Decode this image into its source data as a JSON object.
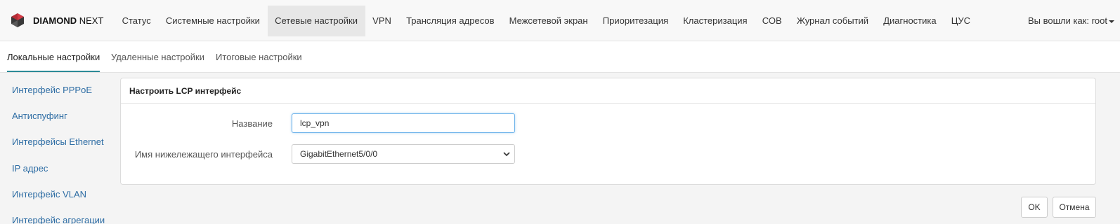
{
  "app": {
    "brand_bold": "DIAMOND",
    "brand_rest": " NEXT",
    "user_label": "Вы вошли как: root"
  },
  "nav": {
    "items": [
      {
        "label": "Статус"
      },
      {
        "label": "Системные настройки"
      },
      {
        "label": "Сетевые настройки",
        "active": true
      },
      {
        "label": "VPN"
      },
      {
        "label": "Трансляция адресов"
      },
      {
        "label": "Межсетевой экран"
      },
      {
        "label": "Приоритезация"
      },
      {
        "label": "Кластеризация"
      },
      {
        "label": "СОВ"
      },
      {
        "label": "Журнал событий"
      },
      {
        "label": "Диагностика"
      },
      {
        "label": "ЦУС"
      }
    ]
  },
  "tabs": [
    {
      "label": "Локальные настройки",
      "active": true
    },
    {
      "label": "Удаленные настройки"
    },
    {
      "label": "Итоговые настройки"
    }
  ],
  "sidebar": {
    "items": [
      {
        "label": "Интерфейс PPPoE"
      },
      {
        "label": "Антиспуфинг"
      },
      {
        "label": "Интерфейсы Ethernet"
      },
      {
        "label": "IP адрес"
      },
      {
        "label": "Интерфейс VLAN"
      },
      {
        "label": "Интерфейс агрегации"
      }
    ]
  },
  "form": {
    "title": "Настроить LCP интерфейс",
    "name_label": "Название",
    "name_value": "lcp_vpn",
    "iface_label": "Имя нижележащего интерфейса",
    "iface_value": "GigabitEthernet5/0/0"
  },
  "buttons": {
    "ok": "OK",
    "cancel": "Отмена"
  },
  "colors": {
    "accent": "#2c8a97",
    "link": "#2e6da4",
    "logo_red": "#d63a45"
  }
}
